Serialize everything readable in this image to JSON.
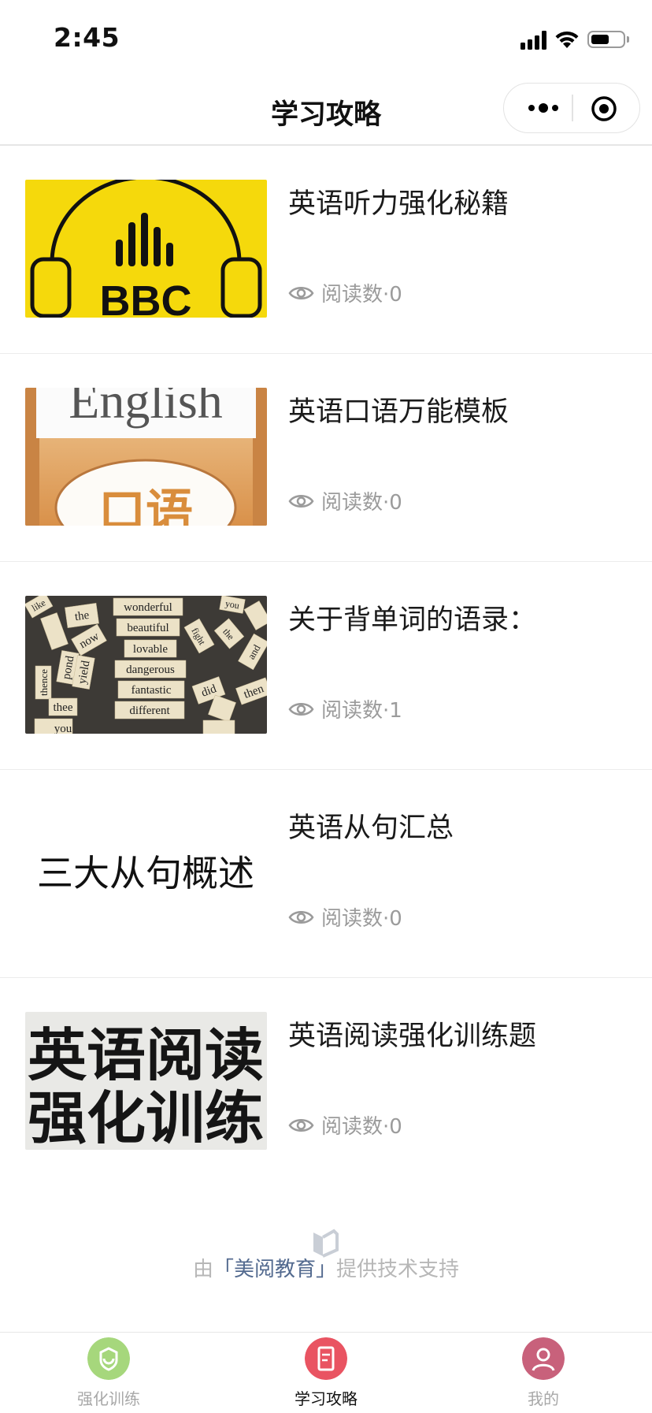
{
  "status_bar": {
    "time": "2:45"
  },
  "nav": {
    "title": "学习攻略"
  },
  "articles": [
    {
      "title": "英语听力强化秘籍",
      "views_label": "阅读数·0",
      "thumb_text": "BBC"
    },
    {
      "title": "英语口语万能模板",
      "views_label": "阅读数·0",
      "thumb_text": [
        "English",
        "口语"
      ]
    },
    {
      "title": "关于背单词的语录：",
      "views_label": "阅读数·1",
      "thumb_words": [
        "wonderful",
        "beautiful",
        "lovable",
        "dangerous",
        "fantastic",
        "different",
        "the",
        "you",
        "like",
        "pond",
        "yield",
        "thee",
        "thence",
        "did",
        "fight",
        "and",
        "then",
        "now",
        "the",
        "you"
      ]
    },
    {
      "title": "英语从句汇总",
      "views_label": "阅读数·0",
      "thumb_text": "三大从句概述"
    },
    {
      "title": "英语阅读强化训练题",
      "views_label": "阅读数·0",
      "thumb_text": [
        "英语阅读",
        "强化训练"
      ]
    }
  ],
  "footer": {
    "prefix": "由",
    "brand": "「美阅教育」",
    "suffix": "提供技术支持"
  },
  "tabbar": {
    "tabs": [
      {
        "label": "强化训练",
        "icon": "training-icon",
        "color": "#a6d77c"
      },
      {
        "label": "学习攻略",
        "icon": "guide-icon",
        "color": "#e95462"
      },
      {
        "label": "我的",
        "icon": "profile-icon",
        "color": "#c8617b"
      }
    ],
    "active_index": 1
  },
  "colors": {
    "accent": "#e95462",
    "meta": "#9b9b9b",
    "brand_link": "#536a8f"
  }
}
